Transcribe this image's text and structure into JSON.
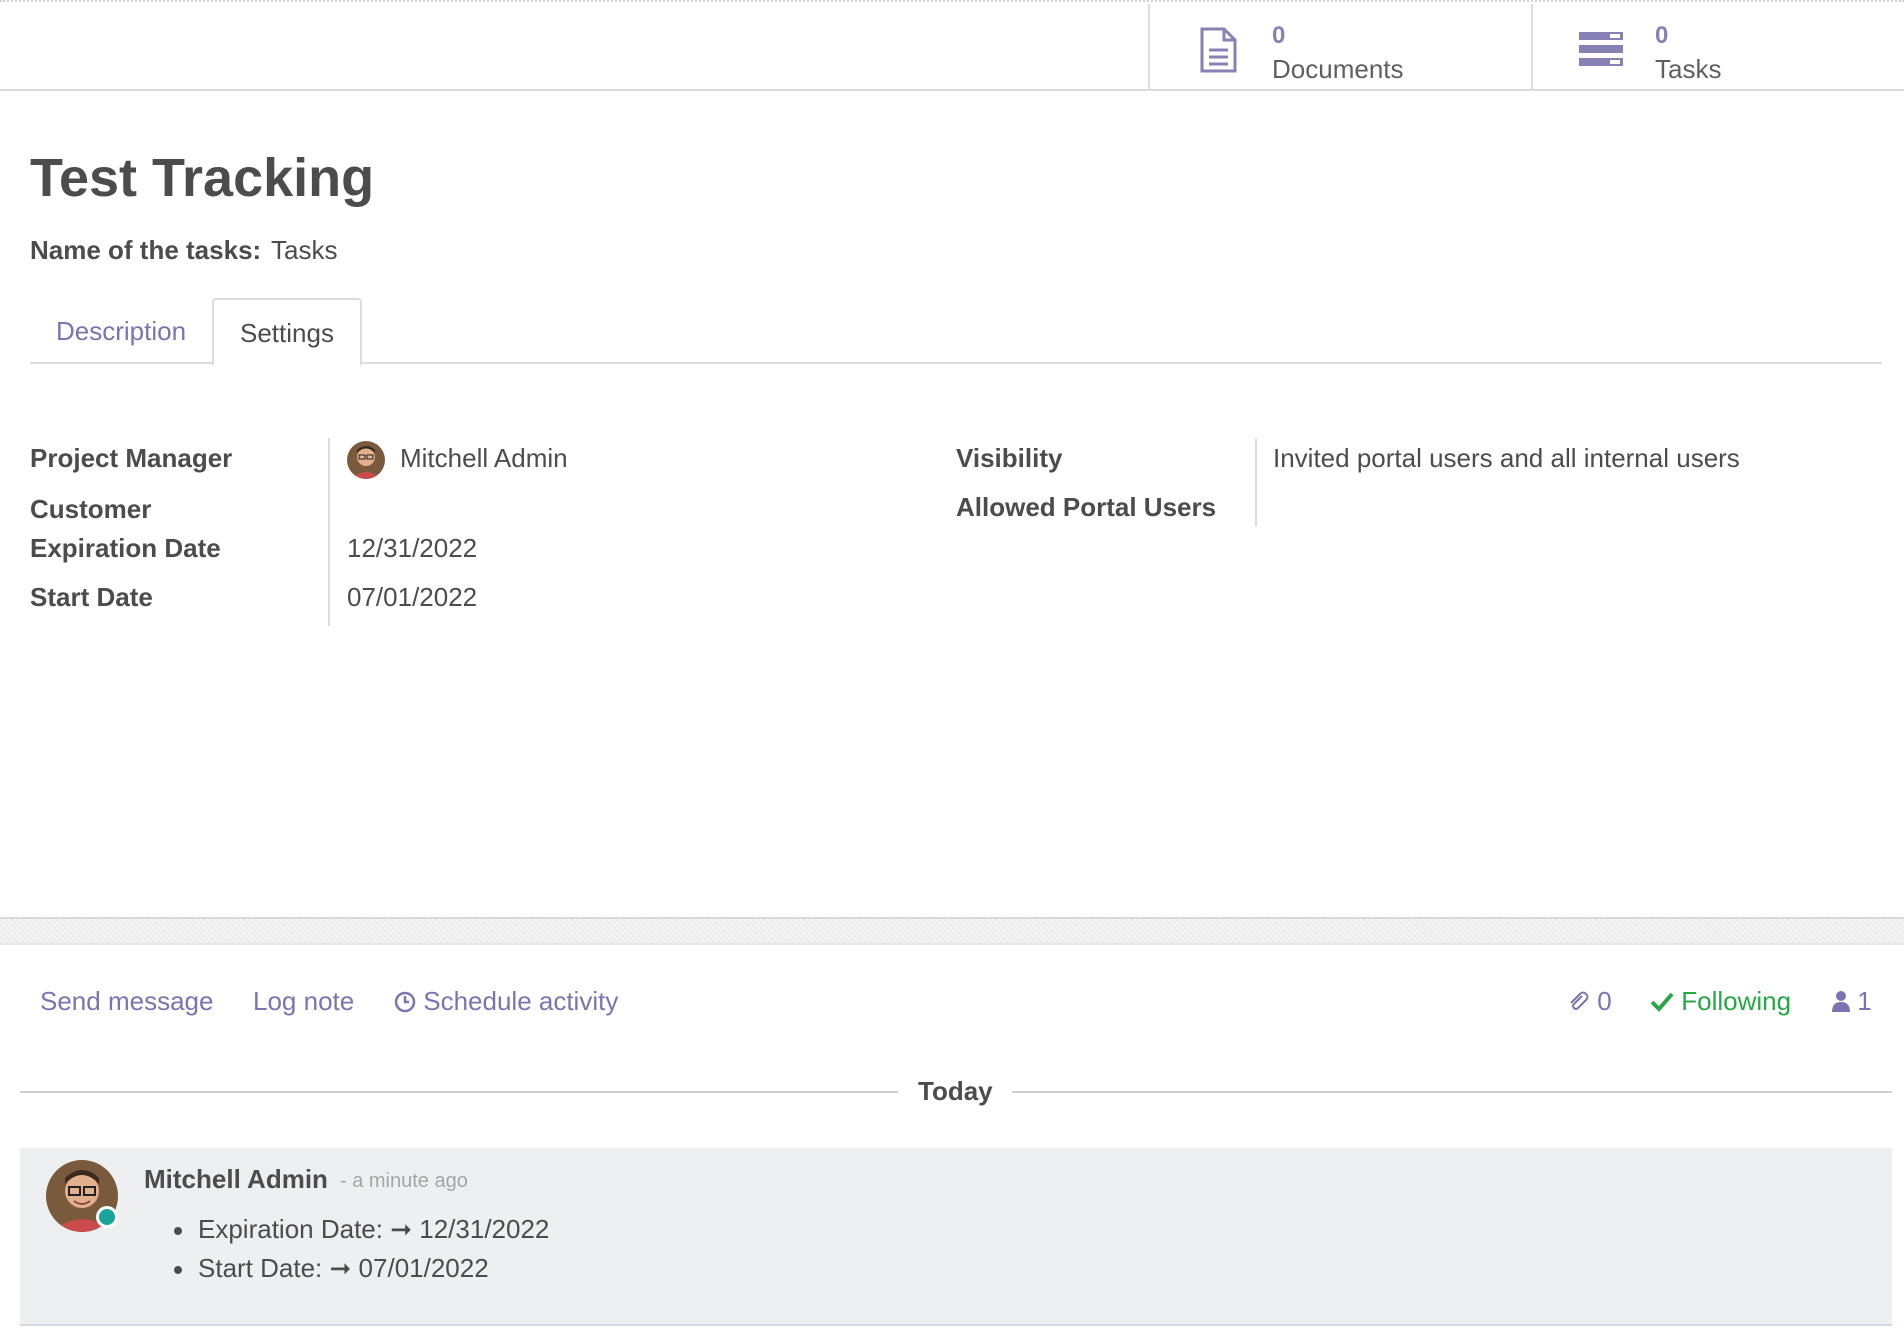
{
  "button_box": {
    "documents": {
      "count": "0",
      "label": "Documents",
      "icon": "file-text-icon"
    },
    "tasks": {
      "count": "0",
      "label": "Tasks",
      "icon": "tasks-icon"
    }
  },
  "record": {
    "title": "Test Tracking",
    "tasks_name_label": "Name of the tasks:",
    "tasks_name_value": "Tasks"
  },
  "tabs": [
    {
      "label": "Description",
      "active": false
    },
    {
      "label": "Settings",
      "active": true
    }
  ],
  "settings": {
    "left": [
      {
        "label": "Project Manager",
        "value": "Mitchell Admin"
      },
      {
        "label": "Customer",
        "value": ""
      },
      {
        "label": "Expiration Date",
        "value": "12/31/2022"
      },
      {
        "label": "Start Date",
        "value": "07/01/2022"
      }
    ],
    "right": [
      {
        "label": "Visibility",
        "value": "Invited portal users and all internal users"
      },
      {
        "label": "Allowed Portal Users",
        "value": ""
      }
    ]
  },
  "chatter": {
    "send_message": "Send message",
    "log_note": "Log note",
    "schedule_activity": "Schedule activity",
    "attachments_count": "0",
    "following": "Following",
    "followers_count": "1",
    "date_separator": "Today",
    "message": {
      "author": "Mitchell Admin",
      "date": "- a minute ago",
      "changes": [
        {
          "field": "Expiration Date:",
          "arrow": "➞",
          "value": "12/31/2022"
        },
        {
          "field": "Start Date:",
          "arrow": "➞",
          "value": "07/01/2022"
        }
      ]
    }
  },
  "colors": {
    "link": "#7a74b0",
    "following": "#28a745",
    "online": "#1aa59a"
  }
}
